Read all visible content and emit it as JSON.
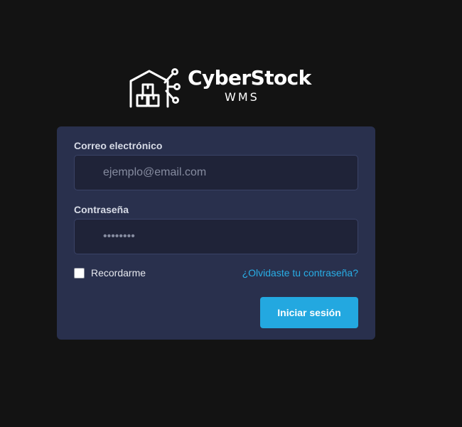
{
  "brand": {
    "name": "CyberStock",
    "subtitle": "WMS",
    "icon": "warehouse-circuit-icon"
  },
  "form": {
    "email": {
      "label": "Correo electrónico",
      "placeholder": "ejemplo@email.com",
      "value": ""
    },
    "password": {
      "label": "Contraseña",
      "placeholder": "••••••••",
      "value": ""
    },
    "remember": {
      "label": "Recordarme",
      "checked": false
    },
    "forgot_link": "¿Olvidaste tu contraseña?",
    "submit_label": "Iniciar sesión"
  },
  "colors": {
    "background": "#131313",
    "card": "#29304d",
    "input_bg": "#1f2338",
    "accent": "#23a8e0",
    "link": "#29aee6"
  }
}
